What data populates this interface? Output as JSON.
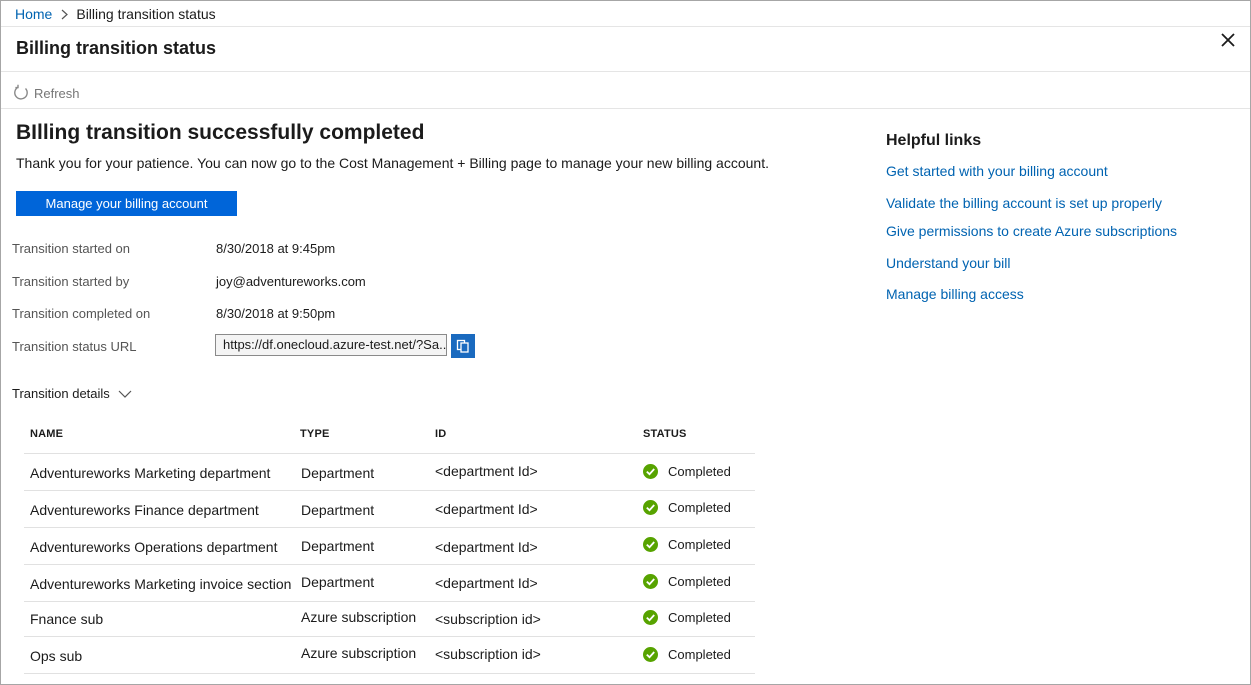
{
  "breadcrumb": {
    "home": "Home",
    "current": "Billing transition status"
  },
  "header": {
    "title": "Billing transition status"
  },
  "toolbar": {
    "refresh_label": "Refresh"
  },
  "main": {
    "heading": "BIlling transition successfully completed",
    "description": "Thank you for your patience. You can now go to the Cost Management + Billing page to manage your new billing account.",
    "manage_button": "Manage your billing account",
    "fields": {
      "started_on_label": "Transition started on",
      "started_on_value": "8/30/2018 at 9:45pm",
      "started_by_label": "Transition started by",
      "started_by_value": "joy@adventureworks.com",
      "completed_on_label": "Transition completed on",
      "completed_on_value": "8/30/2018 at 9:50pm",
      "status_url_label": "Transition status URL",
      "status_url_value": "https://df.onecloud.azure-test.net/?Sa..."
    },
    "details_label": "Transition details"
  },
  "table": {
    "headers": {
      "name": "NAME",
      "type": "TYPE",
      "id": "ID",
      "status": "STATUS"
    },
    "rows": [
      {
        "name": "Adventureworks Marketing department",
        "type": "Department",
        "id": "<department Id>",
        "status": "Completed"
      },
      {
        "name": "Adventureworks Finance department",
        "type": "Department",
        "id": "<department Id>",
        "status": "Completed"
      },
      {
        "name": "Adventureworks Operations department",
        "type": "Department",
        "id": "<department Id>",
        "status": "Completed"
      },
      {
        "name": "Adventureworks Marketing invoice section",
        "type": "Department",
        "id": "<department Id>",
        "status": "Completed"
      },
      {
        "name": "Fnance sub",
        "type": "Azure subscription",
        "id": "<subscription id>",
        "status": "Completed"
      },
      {
        "name": "Ops sub",
        "type": "Azure subscription",
        "id": "<subscription id>",
        "status": "Completed"
      }
    ]
  },
  "helpful_links": {
    "title": "Helpful links",
    "links": [
      "Get started with your billing account",
      "Validate the billing account is set up properly",
      "Give permissions to create Azure subscriptions",
      "Understand your bill",
      "Manage billing access"
    ]
  },
  "colors": {
    "link": "#0063b1",
    "primary_button": "#0065d9",
    "success_green": "#57a300"
  },
  "icons": {
    "refresh": "refresh-icon",
    "close": "close-icon",
    "copy": "copy-icon",
    "chevron": "chevron-down-icon",
    "status": "check-circle-icon"
  }
}
